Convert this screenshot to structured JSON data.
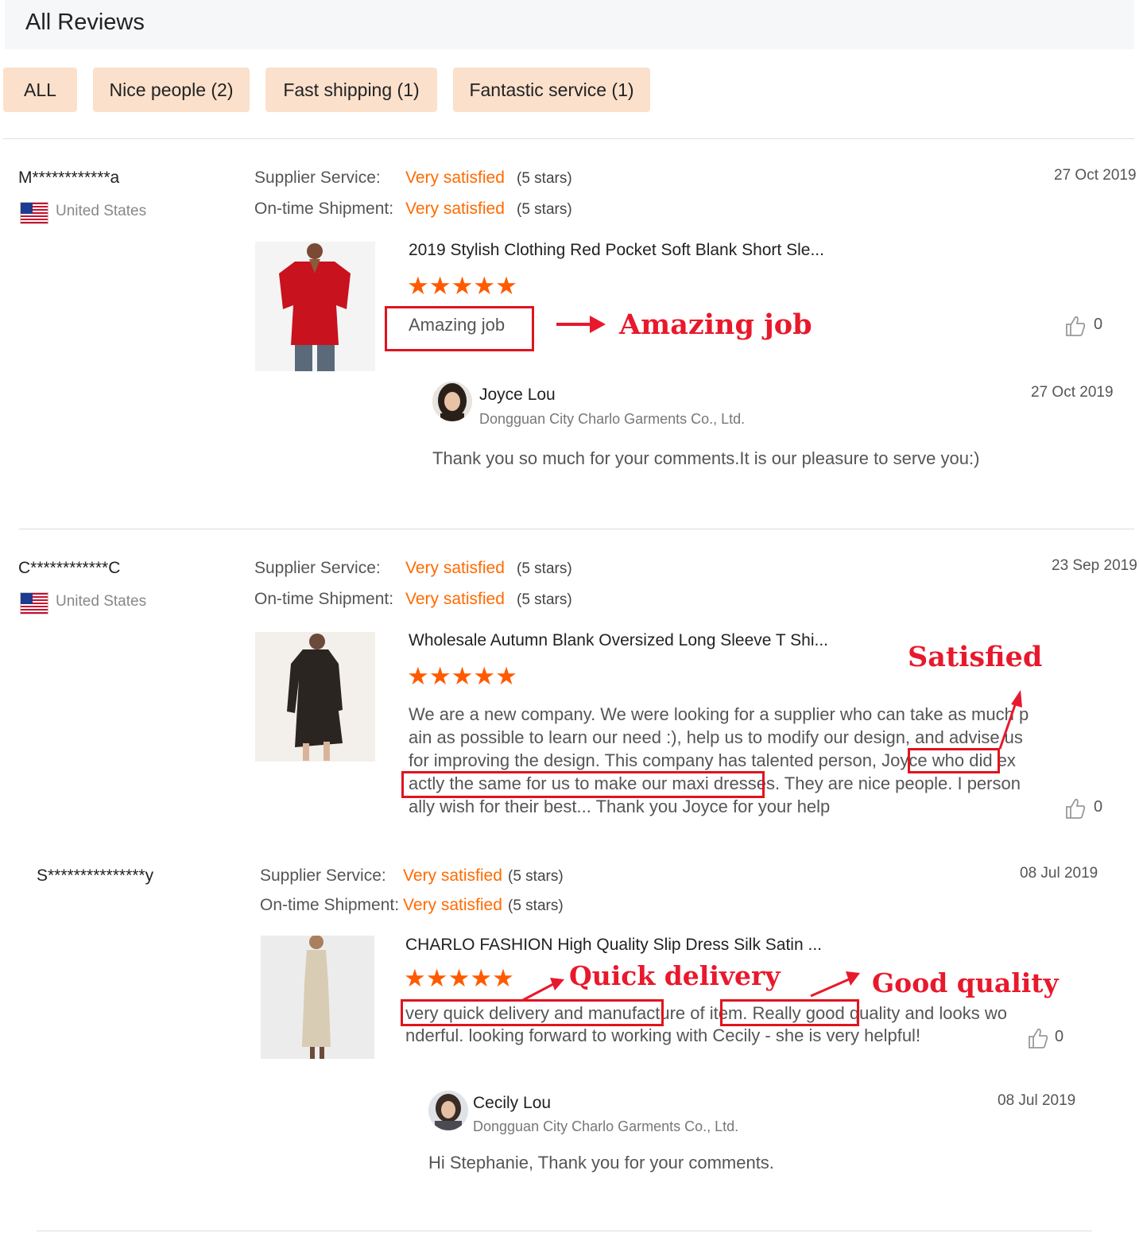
{
  "header": {
    "title": "All Reviews"
  },
  "tabs": [
    "ALL",
    "Nice people (2)",
    "Fast shipping (1)",
    "Fantastic service (1)"
  ],
  "reviews": [
    {
      "user": "M************a",
      "country": "United States",
      "supplier_label": "Supplier Service:",
      "supplier_value": "Very satisfied",
      "supplier_stars": "(5 stars)",
      "shipment_label": "On-time Shipment:",
      "shipment_value": "Very satisfied",
      "shipment_stars": "(5 stars)",
      "date": "27 Oct 2019",
      "product_title": "2019 Stylish Clothing Red Pocket Soft Blank Short Sle...",
      "stars": "★★★★★",
      "text": "Amazing job",
      "likes": "0",
      "reply": {
        "name": "Joyce Lou",
        "company": "Dongguan City Charlo Garments Co., Ltd.",
        "date": "27 Oct 2019",
        "text": "Thank you so much for your comments.It is our pleasure to serve you:)"
      }
    },
    {
      "user": "C************C",
      "country": "United States",
      "supplier_label": "Supplier Service:",
      "supplier_value": "Very satisfied",
      "supplier_stars": "(5 stars)",
      "shipment_label": "On-time Shipment:",
      "shipment_value": "Very satisfied",
      "shipment_stars": "(5 stars)",
      "date": "23 Sep 2019",
      "product_title": "Wholesale Autumn Blank Oversized Long Sleeve T Shi...",
      "stars": "★★★★★",
      "text_lines": [
        "We are a new company. We were looking for a supplier who can take as much p",
        "ain as possible to learn our need :), help us to modify our design, and advise us",
        "for improving the design. This company has talented person, Joyce who did ex",
        "actly the same for us to make our maxi dresses. They are nice people. I person",
        "ally wish for their best... Thank you Joyce for your help"
      ],
      "likes": "0"
    },
    {
      "user": "S***************y",
      "supplier_label": "Supplier Service:",
      "supplier_value": "Very satisfied",
      "supplier_stars": "(5 stars)",
      "shipment_label": "On-time Shipment:",
      "shipment_value": "Very satisfied",
      "shipment_stars": "(5 stars)",
      "date": "08 Jul 2019",
      "product_title": "CHARLO FASHION High Quality Slip Dress Silk Satin ...",
      "stars": "★★★★★",
      "text_lines": [
        "very quick delivery and manufacture of item. Really good quality and looks wo",
        "nderful. looking forward to working with Cecily - she is very helpful!"
      ],
      "likes": "0",
      "reply": {
        "name": "Cecily Lou",
        "company": "Dongguan City Charlo Garments Co., Ltd.",
        "date": "08 Jul 2019",
        "text": "Hi Stephanie, Thank you for your comments."
      }
    }
  ],
  "annotations": {
    "amazing": "Amazing job",
    "satisfied": "Satisfied",
    "quick": "Quick delivery",
    "quality": "Good quality"
  },
  "colors": {
    "accent": "#ff6a00",
    "annotation": "#e8192c",
    "tab_bg": "#fbe0cc"
  },
  "icons": [
    "us-flag-icon",
    "thumbs-up-icon",
    "arrow-icon"
  ]
}
